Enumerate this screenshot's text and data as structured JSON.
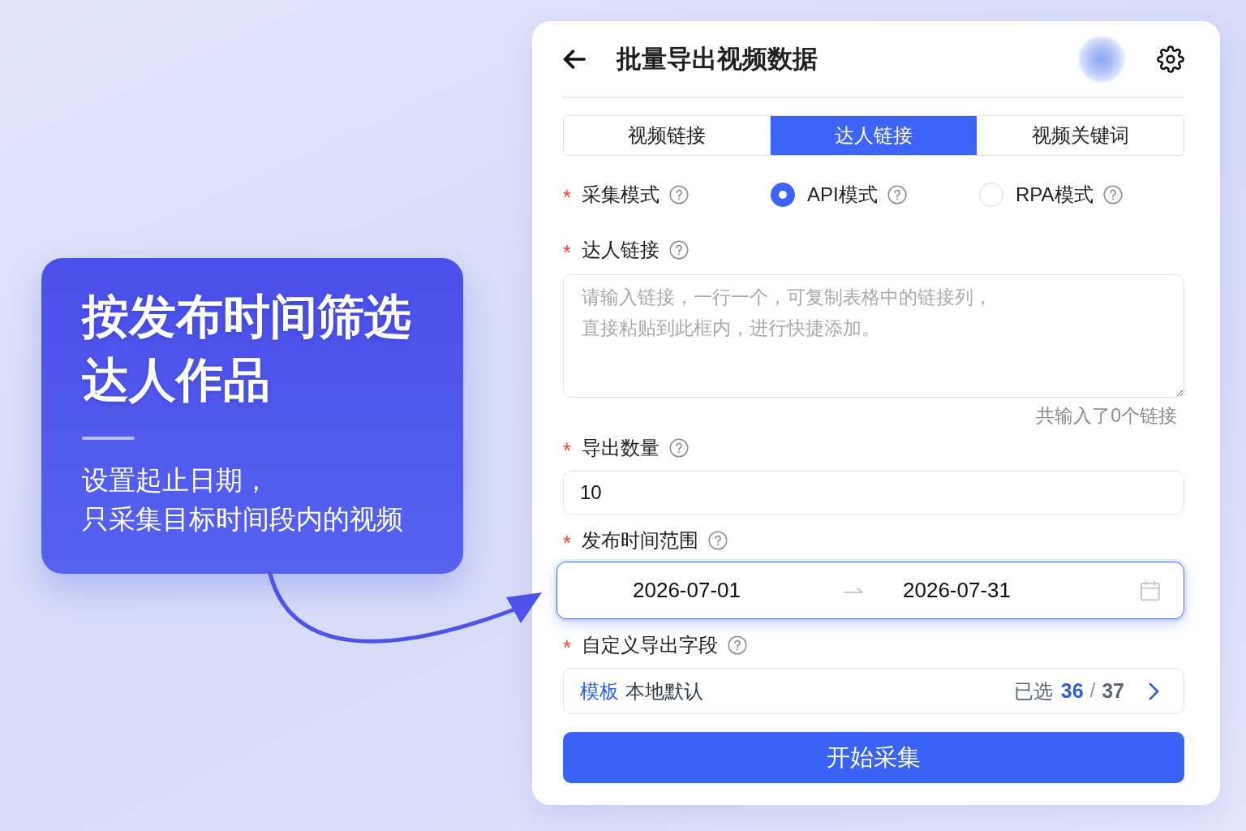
{
  "callout": {
    "title_lines": [
      "按发布时间筛选",
      "达人作品"
    ],
    "subtitle_lines": [
      "设置起止日期，",
      "只采集目标时间段内的视频"
    ]
  },
  "panel": {
    "title": "批量导出视频数据",
    "tabs": [
      {
        "label": "视频链接",
        "selected": false
      },
      {
        "label": "达人链接",
        "selected": true
      },
      {
        "label": "视频关键词",
        "selected": false
      }
    ],
    "fields": [
      {
        "kind": "radio",
        "required_mark": "*",
        "label": "采集模式",
        "options": [
          {
            "label": "API模式",
            "selected": true
          },
          {
            "label": "RPA模式",
            "selected": false
          }
        ]
      },
      {
        "kind": "textarea",
        "required_mark": "*",
        "label": "达人链接",
        "placeholder": "请输入链接，一行一个，可复制表格中的链接列，直接粘贴到此框内，进行快捷添加。",
        "counter": "共输入了0个链接"
      },
      {
        "kind": "input",
        "required_mark": "*",
        "label": "导出数量",
        "value": "10"
      },
      {
        "kind": "daterange",
        "required_mark": "*",
        "label": "发布时间范围",
        "start": "2026-07-01",
        "end": "2026-07-31",
        "focused": true
      },
      {
        "kind": "picker",
        "required_mark": "*",
        "label": "自定义导出字段",
        "template_label": "模板",
        "template_value": "本地默认",
        "selected_label": "已选",
        "selected_count": "36",
        "separator": "/",
        "total": "37"
      }
    ],
    "submit_button": "开始采集"
  }
}
